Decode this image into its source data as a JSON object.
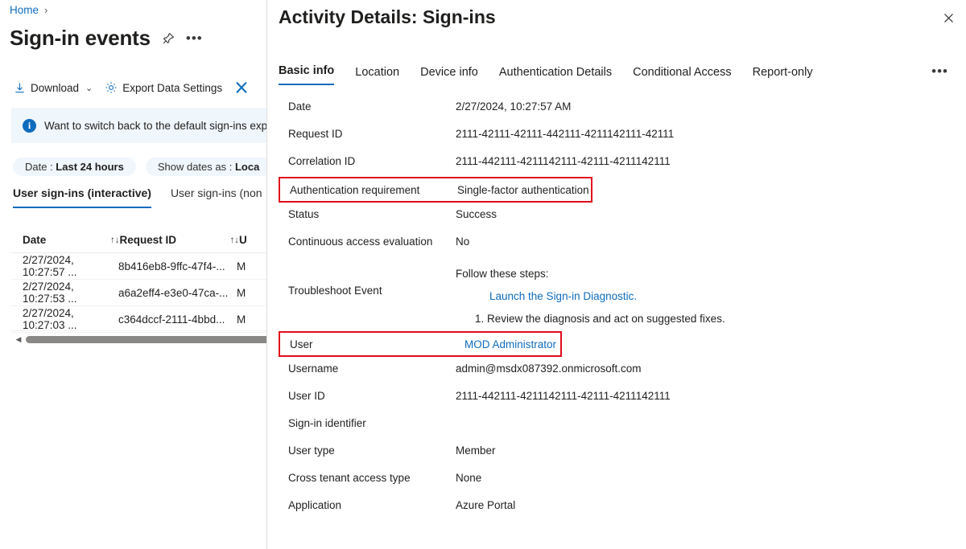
{
  "background": {
    "breadcrumb": {
      "home": "Home",
      "separator": "›"
    },
    "page_title": "Sign-in events",
    "icons": {
      "pin": "pin-icon",
      "more": "ellipsis-icon"
    },
    "command_bar": {
      "download": "Download",
      "download_chevron": "⌄",
      "export_data_settings": "Export Data Settings",
      "troubleshoot_icon": "troubleshoot-wrench-icon"
    },
    "info_banner": {
      "icon": "info-icon",
      "text": "Want to switch back to the default sign-ins experi"
    },
    "filter_pills": [
      {
        "label": "Date : ",
        "value": "Last 24 hours"
      },
      {
        "label": "Show dates as : ",
        "value": "Loca"
      }
    ],
    "sub_tabs": [
      {
        "label": "User sign-ins (interactive)",
        "active": true
      },
      {
        "label": "User sign-ins (non",
        "active": false
      }
    ],
    "grid": {
      "columns": [
        {
          "label": "Date",
          "sort_icon": "↑↓"
        },
        {
          "label": "Request ID",
          "sort_icon": "↑↓"
        },
        {
          "label": "U",
          "sort_icon": ""
        }
      ],
      "rows": [
        {
          "date": "2/27/2024, 10:27:57 ...",
          "request_id": "8b416eb8-9ffc-47f4-...",
          "user": "M"
        },
        {
          "date": "2/27/2024, 10:27:53 ...",
          "request_id": "a6a2eff4-e3e0-47ca-...",
          "user": "M"
        },
        {
          "date": "2/27/2024, 10:27:03 ...",
          "request_id": "c364dccf-2111-4bbd...",
          "user": "M"
        }
      ],
      "scrollbar": {
        "left_arrow": "◀"
      }
    }
  },
  "panel": {
    "title": "Activity Details: Sign-ins",
    "close_icon": "close-icon",
    "more_icon": "ellipsis-icon",
    "tabs": [
      {
        "label": "Basic info",
        "active": true
      },
      {
        "label": "Location",
        "active": false
      },
      {
        "label": "Device info",
        "active": false
      },
      {
        "label": "Authentication Details",
        "active": false
      },
      {
        "label": "Conditional Access",
        "active": false
      },
      {
        "label": "Report-only",
        "active": false
      }
    ],
    "details": {
      "date": {
        "label": "Date",
        "value": "2/27/2024, 10:27:57 AM"
      },
      "request_id": {
        "label": "Request ID",
        "value": "2111-42111-42111-442111-4211142111-42111"
      },
      "correlation_id": {
        "label": "Correlation ID",
        "value": "2111-442111-4211142111-42111-4211142111"
      },
      "auth_requirement": {
        "label": "Authentication requirement",
        "value": "Single-factor authentication"
      },
      "status": {
        "label": "Status",
        "value": "Success"
      },
      "continuous_access": {
        "label": "Continuous access evaluation",
        "value": "No"
      },
      "troubleshoot": {
        "label": "Troubleshoot Event",
        "intro": "Follow these steps:",
        "link": "Launch the Sign-in Diagnostic.",
        "step1": "1. Review the diagnosis and act on suggested fixes."
      },
      "user": {
        "label": "User",
        "value": "MOD Administrator"
      },
      "username": {
        "label": "Username",
        "value": "admin@msdx087392.onmicrosoft.com"
      },
      "user_id": {
        "label": "User ID",
        "value": "2111-442111-4211142111-42111-4211142111"
      },
      "signin_identifier": {
        "label": "Sign-in identifier",
        "value": ""
      },
      "user_type": {
        "label": "User type",
        "value": "Member"
      },
      "cross_tenant": {
        "label": "Cross tenant access type",
        "value": "None"
      },
      "application": {
        "label": "Application",
        "value": "Azure Portal"
      }
    }
  },
  "colors": {
    "accent_blue": "#0f6cbd",
    "highlight_red": "#e00b1c",
    "banner_bg": "#eff6fc",
    "pill_bg": "#eff6fc"
  }
}
